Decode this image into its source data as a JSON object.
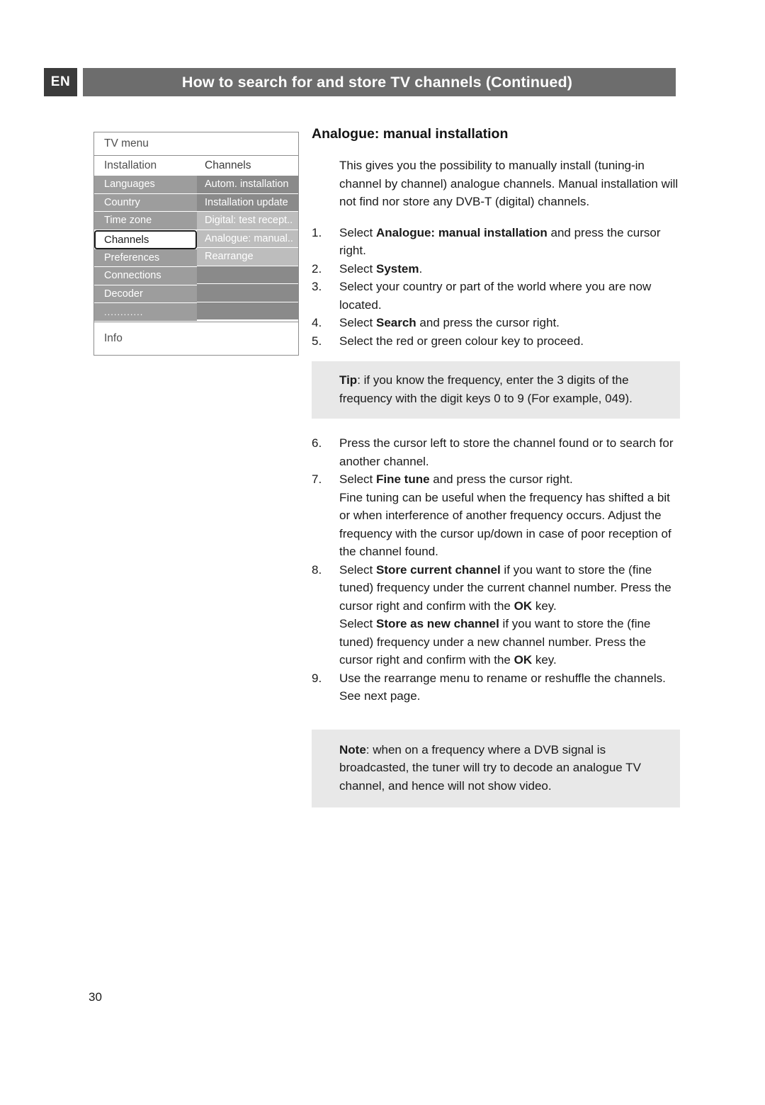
{
  "header": {
    "language_code": "EN",
    "title": "How to search for and store TV channels  (Continued)"
  },
  "tv_menu": {
    "title": "TV menu",
    "left_subhead": "Installation",
    "right_subhead": "Channels",
    "left_items": [
      "Languages",
      "Country",
      "Time zone",
      "Channels",
      "Preferences",
      "Connections",
      "Decoder",
      "............"
    ],
    "selected_left_item": "Channels",
    "right_items": [
      "Autom. installation",
      "Installation update",
      "Digital: test recept..",
      "Analogue: manual..",
      "Rearrange"
    ],
    "highlighted_right_item": "Digital: test recept..",
    "info_label": "Info"
  },
  "content": {
    "section_title": "Analogue: manual installation",
    "intro": "This gives you the possibility to manually install (tuning-in channel by channel) analogue channels. Manual installation will not find nor store any DVB-T (digital) channels.",
    "steps": [
      {
        "num": "1.",
        "parts": [
          {
            "text": "Select ",
            "bold": false
          },
          {
            "text": "Analogue: manual installation",
            "bold": true
          },
          {
            "text": " and press the cursor right.",
            "bold": false
          }
        ]
      },
      {
        "num": "2.",
        "parts": [
          {
            "text": "Select ",
            "bold": false
          },
          {
            "text": "System",
            "bold": true
          },
          {
            "text": ".",
            "bold": false
          }
        ]
      },
      {
        "num": "3.",
        "parts": [
          {
            "text": "Select your country or part of the world where you are now located.",
            "bold": false
          }
        ]
      },
      {
        "num": "4.",
        "parts": [
          {
            "text": "Select ",
            "bold": false
          },
          {
            "text": "Search",
            "bold": true
          },
          {
            "text": " and press the cursor right.",
            "bold": false
          }
        ]
      },
      {
        "num": "5.",
        "parts": [
          {
            "text": "Select the red or green colour key to proceed.",
            "bold": false
          }
        ]
      }
    ],
    "tip": {
      "label": "Tip",
      "text": ": if you know the frequency, enter the 3 digits of the frequency with the digit keys 0 to 9 (For example, 049)."
    },
    "steps2": [
      {
        "num": "6.",
        "parts": [
          {
            "text": "Press the cursor left to store the channel found or to search for another channel.",
            "bold": false
          }
        ]
      },
      {
        "num": "7.",
        "parts": [
          {
            "text": "Select ",
            "bold": false
          },
          {
            "text": "Fine tune",
            "bold": true
          },
          {
            "text": " and press the cursor right.",
            "bold": false
          },
          {
            "text": "\nFine tuning can be useful when the frequency has shifted a bit or when interference of another frequency occurs. Adjust the frequency with the cursor up/down in case of poor reception of the channel found.",
            "bold": false
          }
        ]
      },
      {
        "num": "8.",
        "parts": [
          {
            "text": "Select ",
            "bold": false
          },
          {
            "text": "Store current channel",
            "bold": true
          },
          {
            "text": " if you want to store the (fine tuned) frequency under the current channel number. Press the cursor right and confirm with the ",
            "bold": false
          },
          {
            "text": "OK",
            "bold": true
          },
          {
            "text": " key.",
            "bold": false
          },
          {
            "text": "\nSelect ",
            "bold": false
          },
          {
            "text": "Store as new channel",
            "bold": true
          },
          {
            "text": " if you want to store the (fine tuned) frequency under a new channel number. Press the cursor right and confirm with the ",
            "bold": false
          },
          {
            "text": "OK",
            "bold": true
          },
          {
            "text": " key.",
            "bold": false
          }
        ]
      },
      {
        "num": "9.",
        "parts": [
          {
            "text": "Use the rearrange menu to rename or reshuffle the channels. See next page.",
            "bold": false
          }
        ]
      }
    ],
    "note": {
      "label": "Note",
      "text": ": when on a frequency where a DVB signal is broadcasted, the tuner will try to decode an analogue TV channel, and hence will not show video."
    }
  },
  "page_number": "30"
}
